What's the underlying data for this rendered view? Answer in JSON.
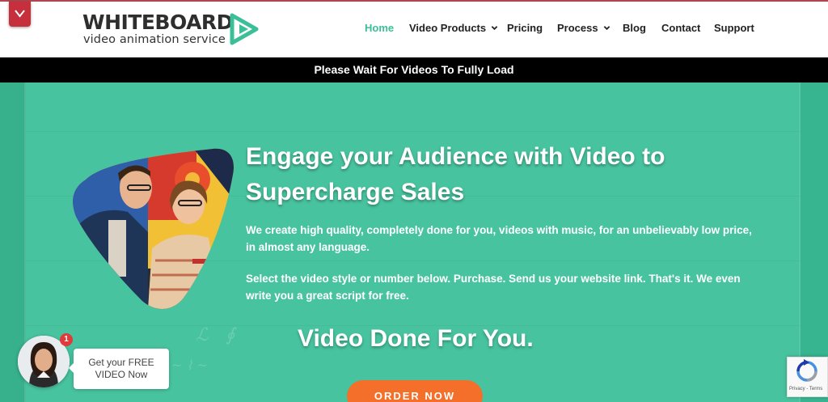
{
  "logo": {
    "word": "WHITEBOARD",
    "sub": "video animation service"
  },
  "nav": [
    {
      "label": "Home",
      "active": true
    },
    {
      "label": "Video Products",
      "dropdown": true
    },
    {
      "label": "Pricing"
    },
    {
      "label": "Process",
      "dropdown": true
    },
    {
      "label": "Blog"
    },
    {
      "label": "Contact"
    },
    {
      "label": "Support"
    }
  ],
  "notice": "Please Wait For Videos To Fully Load",
  "hero": {
    "headline_line1": "Engage your Audience with Video to",
    "headline_line2": "Supercharge Sales",
    "para1_line1": "We create high quality, completely done for you, videos with music, for an unbelievably low price,",
    "para1_line2": "in almost any language.",
    "para2_line1": "Select the video style or number below. Purchase. Send us your website link. That's it. We even",
    "para2_line2": "write you a great script for free.",
    "subheadline": "Video Done For You.",
    "cta": "ORDER NOW"
  },
  "chat": {
    "badge": "1",
    "line1": "Get your FREE",
    "line2": "VIDEO Now"
  },
  "recaptcha": {
    "footer": "Privacy - Terms"
  },
  "colors": {
    "accent": "#3abf98",
    "hero_bg": "#3fc09a",
    "cta": "#f36f2a",
    "brand_red": "#c5303c"
  }
}
